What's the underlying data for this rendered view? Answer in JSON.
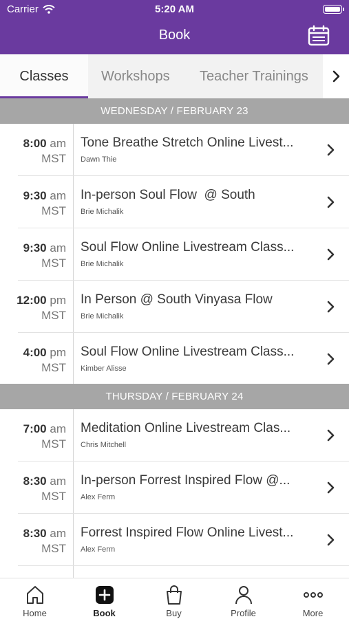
{
  "status_bar": {
    "carrier": "Carrier",
    "time": "5:20 AM"
  },
  "header": {
    "title": "Book",
    "calendar_icon": "calendar-icon"
  },
  "tabs": [
    {
      "label": "Classes",
      "active": true
    },
    {
      "label": "Workshops",
      "active": false
    },
    {
      "label": "Teacher Trainings",
      "active": false
    }
  ],
  "sections": [
    {
      "date": "WEDNESDAY / FEBRUARY 23",
      "classes": [
        {
          "time": "8:00",
          "ampm": "am",
          "tz": "MST",
          "name": "Tone Breathe Stretch Online Livest...",
          "teacher": "Dawn Thie"
        },
        {
          "time": "9:30",
          "ampm": "am",
          "tz": "MST",
          "name": "In-person Soul Flow  @ South",
          "teacher": "Brie Michalik"
        },
        {
          "time": "9:30",
          "ampm": "am",
          "tz": "MST",
          "name": "Soul Flow Online Livestream Class...",
          "teacher": "Brie Michalik"
        },
        {
          "time": "12:00",
          "ampm": "pm",
          "tz": "MST",
          "name": "In Person @ South Vinyasa Flow",
          "teacher": "Brie Michalik"
        },
        {
          "time": "4:00",
          "ampm": "pm",
          "tz": "MST",
          "name": "Soul Flow Online Livestream Class...",
          "teacher": "Kimber Alisse"
        }
      ]
    },
    {
      "date": "THURSDAY / FEBRUARY 24",
      "classes": [
        {
          "time": "7:00",
          "ampm": "am",
          "tz": "MST",
          "name": "Meditation Online Livestream Clas...",
          "teacher": "Chris Mitchell"
        },
        {
          "time": "8:30",
          "ampm": "am",
          "tz": "MST",
          "name": "In-person Forrest Inspired Flow @...",
          "teacher": "Alex Ferm"
        },
        {
          "time": "8:30",
          "ampm": "am",
          "tz": "MST",
          "name": "Forrest Inspired Flow Online Livest...",
          "teacher": "Alex Ferm"
        }
      ]
    }
  ],
  "bottom_nav": [
    {
      "label": "Home",
      "icon": "home-icon",
      "active": false
    },
    {
      "label": "Book",
      "icon": "book-plus-icon",
      "active": true
    },
    {
      "label": "Buy",
      "icon": "shopping-bag-icon",
      "active": false
    },
    {
      "label": "Profile",
      "icon": "person-icon",
      "active": false
    },
    {
      "label": "More",
      "icon": "more-dots-icon",
      "active": false
    }
  ],
  "colors": {
    "brand": "#6a3a9f",
    "date_header": "#a6a6a6"
  }
}
